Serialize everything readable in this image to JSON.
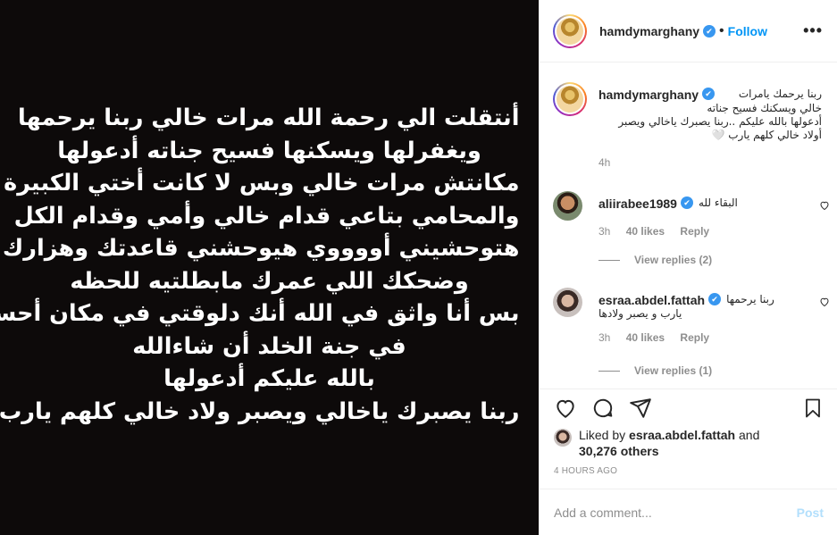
{
  "post": {
    "image_text_lines": [
      "أنتقلت الي رحمة الله مرات خالي ربنا يرحمها",
      "ويغفرلها ويسكنها فسيح جناته أدعولها",
      "مكانتش مرات خالي وبس لا كانت أختي الكبيرة",
      "والمحامي بتاعي قدام خالي وأمي وقدام الكل",
      "هتوحشيني أووووي هيوحشني قاعدتك وهزارك",
      "وضحكك اللي عمرك مابطلتيه للحظه",
      "بس أنا واثق في الله أنك دلوقتي في مكان أحسن",
      "في جنة الخلد أن شاءالله",
      "بالله عليكم أدعولها",
      "ربنا يصبرك ياخالي ويصبر ولاد خالي كلهم يارب"
    ]
  },
  "header": {
    "username": "hamdymarghany",
    "verified_icon": "✔",
    "separator": "•",
    "follow_label": "Follow",
    "more_icon": "•••"
  },
  "caption": {
    "username": "hamdymarghany",
    "text_lines": [
      "ربنا يرحمك يامرات",
      "خالي ويسكنك فسيح جناته",
      "أدعولها بالله عليكم ..ربنا يصبرك ياخالي ويصبر",
      "أولاد خالي كلهم يارب 🤍"
    ],
    "time": "4h"
  },
  "comments": [
    {
      "username": "aliirabee1989",
      "text_lines": [
        "البقاء لله"
      ],
      "time": "3h",
      "likes": "40 likes",
      "reply_label": "Reply",
      "view_replies": "View replies (2)"
    },
    {
      "username": "esraa.abdel.fattah",
      "text_lines": [
        "ربنا يرحمها",
        "يارب و يصبر ولادها"
      ],
      "time": "3h",
      "likes": "40 likes",
      "reply_label": "Reply",
      "view_replies": "View replies (1)"
    }
  ],
  "icons": {
    "heart": "heart-icon",
    "comment": "comment-icon",
    "share": "share-icon",
    "save": "bookmark-icon"
  },
  "likes": {
    "prefix": "Liked by ",
    "user": "esraa.abdel.fattah",
    "middle": " and",
    "others": "30,276 others"
  },
  "timestamp": "4 HOURS AGO",
  "add_comment": {
    "placeholder": "Add a comment...",
    "post_label": "Post"
  },
  "colors": {
    "image_background": "#0d0a0a",
    "accent": "#0095f6",
    "verified": "#3897f0",
    "muted": "#8e8e8e"
  }
}
